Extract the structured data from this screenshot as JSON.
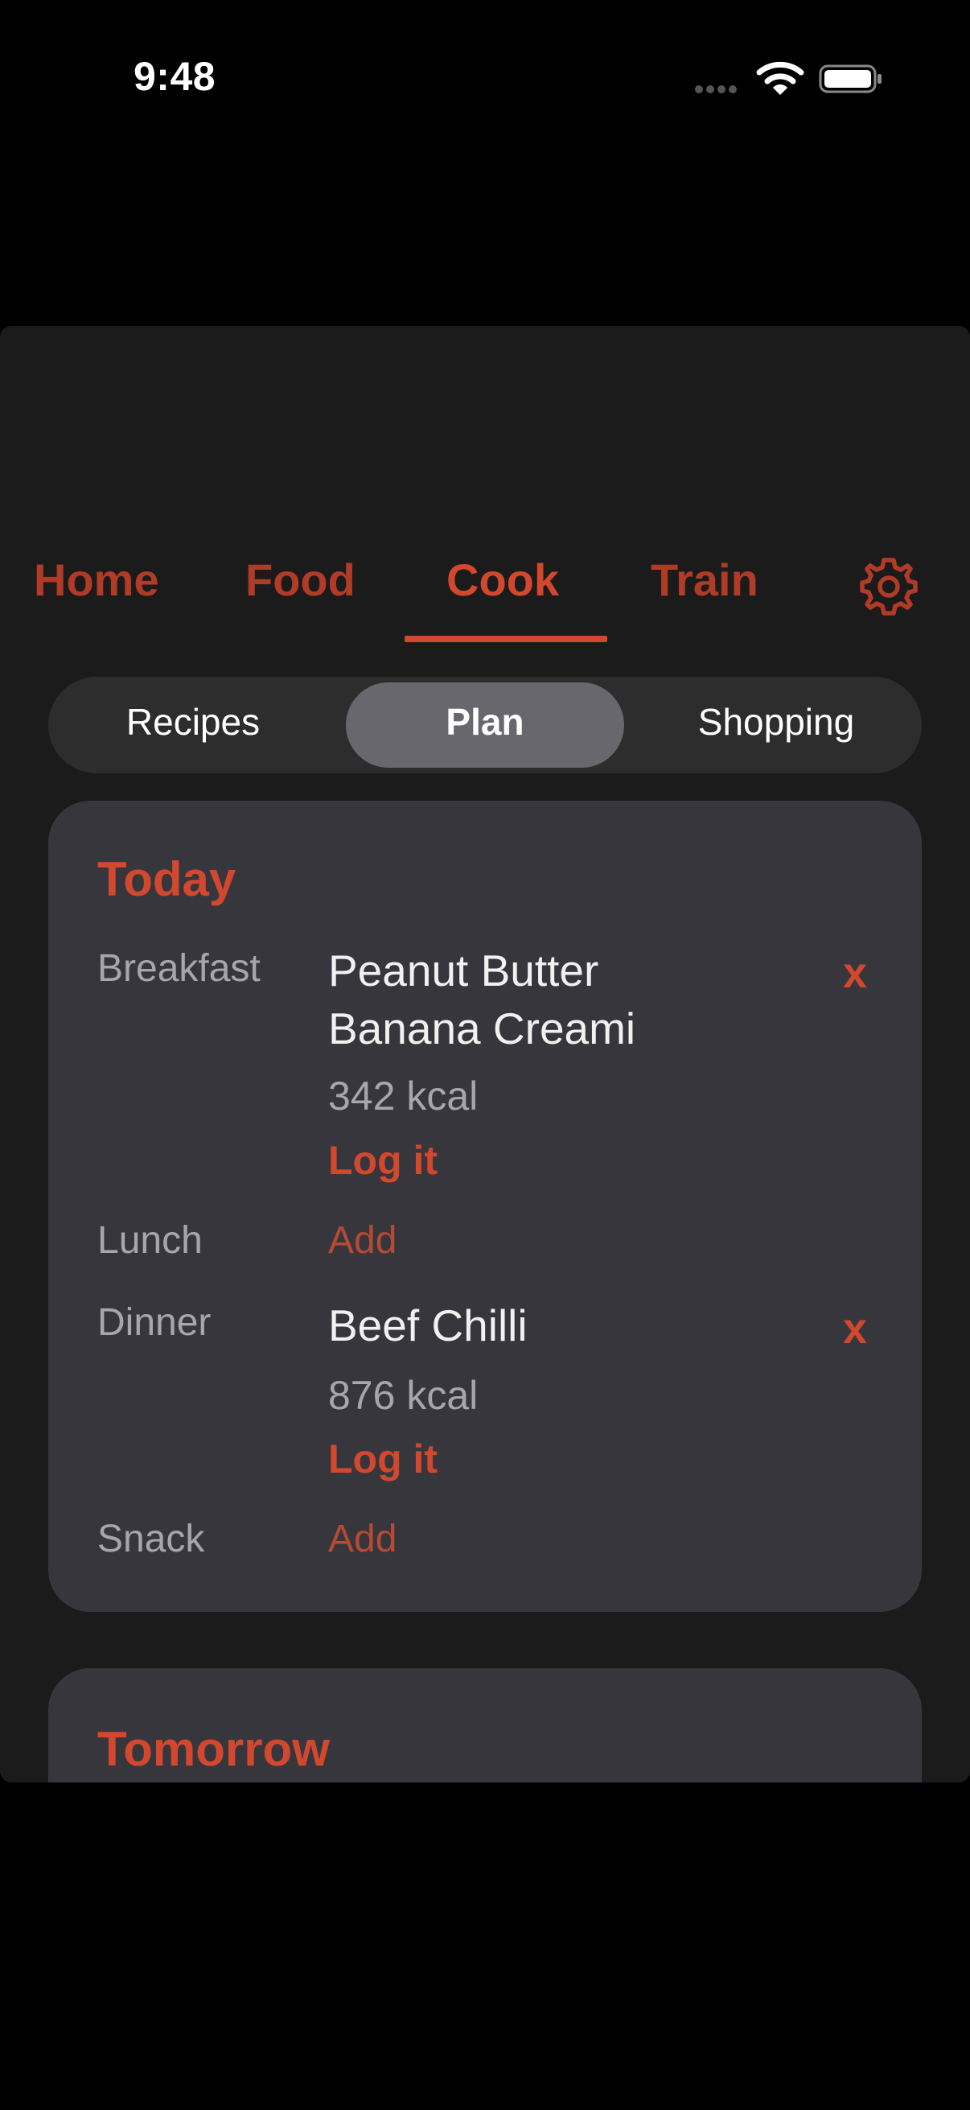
{
  "status_bar": {
    "time": "9:48"
  },
  "nav": {
    "tabs": [
      "Home",
      "Food",
      "Cook",
      "Train"
    ],
    "active_tab": "Cook",
    "settings_icon": "gear-icon"
  },
  "segments": {
    "items": [
      "Recipes",
      "Plan",
      "Shopping"
    ],
    "active": "Plan"
  },
  "today": {
    "title": "Today",
    "breakfast": {
      "label": "Breakfast",
      "dish_line1": "Peanut Butter",
      "dish_line2": "Banana Creami",
      "kcal": "342 kcal",
      "log": "Log it",
      "remove": "x"
    },
    "lunch": {
      "label": "Lunch",
      "add": "Add"
    },
    "dinner": {
      "label": "Dinner",
      "dish": "Beef Chilli",
      "kcal": "876 kcal",
      "log": "Log it",
      "remove": "x"
    },
    "snack": {
      "label": "Snack",
      "add": "Add"
    }
  },
  "tomorrow": {
    "title": "Tomorrow"
  },
  "colors": {
    "accent": "#d2482f",
    "background": "#000000",
    "panel": "#1c1b1b",
    "card": "#37363c"
  }
}
